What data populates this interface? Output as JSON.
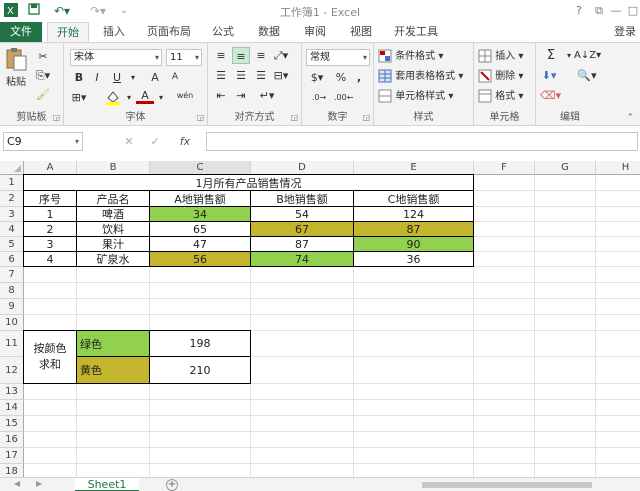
{
  "titlebar": {
    "title": "工作簿1 - Excel",
    "help": "?",
    "restore": "⧉",
    "minimize": "—",
    "maximize": "□",
    "close": "✕"
  },
  "tabs": [
    {
      "label": "文件"
    },
    {
      "label": "开始"
    },
    {
      "label": "插入"
    },
    {
      "label": "页面布局"
    },
    {
      "label": "公式"
    },
    {
      "label": "数据"
    },
    {
      "label": "审阅"
    },
    {
      "label": "视图"
    },
    {
      "label": "开发工具"
    }
  ],
  "login": "登录",
  "ribbon": {
    "clipboard": {
      "label": "剪贴板",
      "paste": "粘贴"
    },
    "font": {
      "label": "字体",
      "name": "宋体",
      "size": "11",
      "bold": "B",
      "italic": "I",
      "underline": "U",
      "grow": "A",
      "shrink": "A",
      "color_a": "A",
      "wen": "wén"
    },
    "alignment": {
      "label": "对齐方式"
    },
    "number": {
      "label": "数字",
      "format": "常规",
      "percent": "%",
      "comma": ","
    },
    "styles": {
      "label": "样式",
      "conditional": "条件格式",
      "table": "套用表格格式",
      "cell": "单元格样式"
    },
    "cells": {
      "label": "单元格",
      "insert": "插入",
      "delete": "删除",
      "format": "格式"
    },
    "editing": {
      "label": "编辑",
      "sigma": "Σ"
    }
  },
  "formula_bar": {
    "name_box": "C9",
    "fx": "fx",
    "cancel": "✕",
    "enter": "✓"
  },
  "columns": [
    "A",
    "B",
    "C",
    "D",
    "E",
    "F",
    "G",
    "H"
  ],
  "rows": [
    "1",
    "2",
    "3",
    "4",
    "5",
    "6",
    "7",
    "8",
    "9",
    "10",
    "11",
    "12",
    "13",
    "14",
    "15",
    "16",
    "17",
    "18"
  ],
  "sheet": {
    "title": "1月所有产品销售情况",
    "headers": [
      "序号",
      "产品名",
      "A地销售额",
      "B地销售额",
      "C地销售额"
    ],
    "data": [
      [
        "1",
        "啤酒",
        "34",
        "54",
        "124"
      ],
      [
        "2",
        "饮料",
        "65",
        "67",
        "87"
      ],
      [
        "3",
        "果汁",
        "47",
        "87",
        "90"
      ],
      [
        "4",
        "矿泉水",
        "56",
        "74",
        "36"
      ]
    ],
    "sum_label": "按颜色求和",
    "green_label": "绿色",
    "green_sum": "198",
    "yellow_label": "黄色",
    "yellow_sum": "210"
  },
  "colors": {
    "green": "#92d050",
    "olive": "#c4b52f",
    "accent": "#217346"
  },
  "sheet_tab": "Sheet1"
}
